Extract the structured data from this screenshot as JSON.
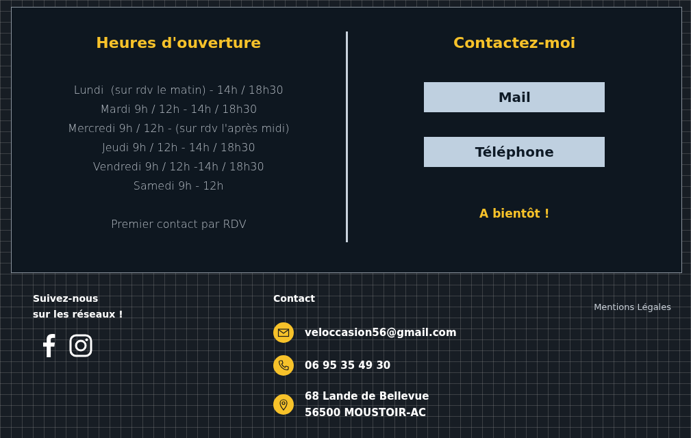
{
  "hours": {
    "title": "Heures d'ouverture",
    "lines": [
      "Lundi  (sur rdv le matin) - 14h / 18h30",
      "Mardi 9h / 12h - 14h / 18h30",
      "Mercredi 9h / 12h - (sur rdv l'après midi)",
      "Jeudi 9h / 12h - 14h / 18h30",
      "Vendredi 9h / 12h -14h / 18h30",
      "Samedi 9h - 12h"
    ],
    "note": "Premier contact par RDV"
  },
  "contact_panel": {
    "title": "Contactez-moi",
    "buttons": [
      "Mail",
      "Téléphone"
    ],
    "closing": "A bientôt !"
  },
  "footer": {
    "social": {
      "title": "Suivez-nous\nsur les réseaux !"
    },
    "contact": {
      "title": "Contact",
      "items": [
        {
          "kind": "email",
          "lines": [
            "veloccasion56@gmail.com"
          ]
        },
        {
          "kind": "phone",
          "lines": [
            "06 95 35 49 30"
          ]
        },
        {
          "kind": "address",
          "lines": [
            "68 Lande de Bellevue",
            "56500 MOUSTOIR-AC"
          ]
        }
      ]
    },
    "legal_link": "Mentions Légales"
  }
}
